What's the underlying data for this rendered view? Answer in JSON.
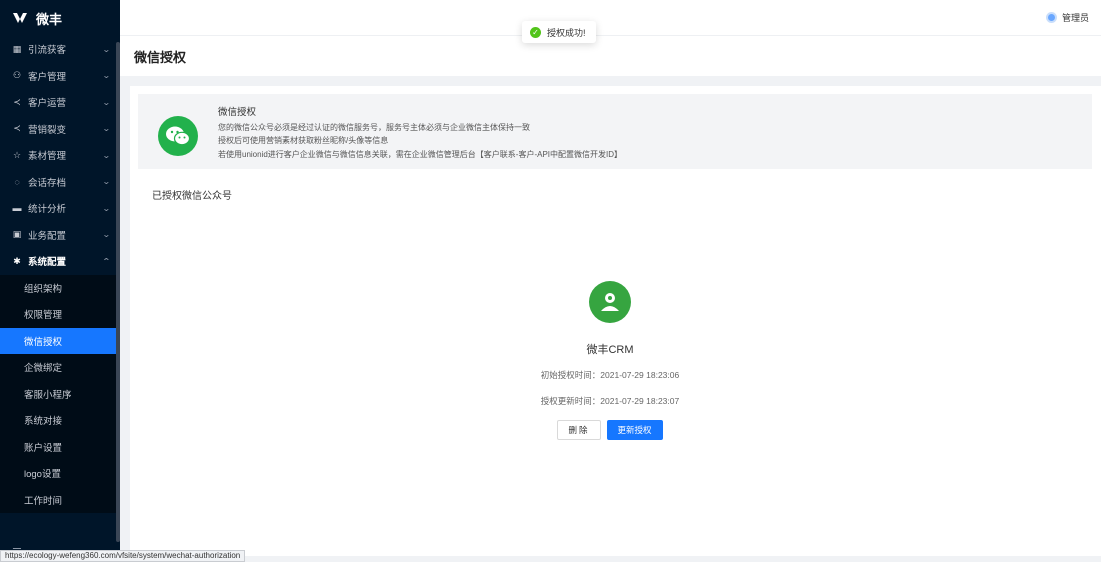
{
  "app": {
    "name": "微丰"
  },
  "sidebar": {
    "items": [
      {
        "label": "引流获客",
        "icon": "qr-code-icon",
        "glyph": "▦"
      },
      {
        "label": "客户管理",
        "icon": "users-icon",
        "glyph": "⚇"
      },
      {
        "label": "客户运营",
        "icon": "share-icon",
        "glyph": "≺"
      },
      {
        "label": "营销裂变",
        "icon": "share-icon",
        "glyph": "≺"
      },
      {
        "label": "素材管理",
        "icon": "star-icon",
        "glyph": "☆"
      },
      {
        "label": "会话存档",
        "icon": "chat-icon",
        "glyph": "◌"
      },
      {
        "label": "统计分析",
        "icon": "bar-chart-icon",
        "glyph": "▬"
      },
      {
        "label": "业务配置",
        "icon": "grid-icon",
        "glyph": "▣"
      },
      {
        "label": "系统配置",
        "icon": "gear-icon",
        "glyph": "✱"
      }
    ],
    "subitems": [
      "组织架构",
      "权限管理",
      "微信授权",
      "企微绑定",
      "客服小程序",
      "系统对接",
      "账户设置",
      "logo设置",
      "工作时间"
    ],
    "active_subitem": "微信授权",
    "footer_glyph": "☰"
  },
  "header": {
    "user_name": "管理员"
  },
  "toast": {
    "text": "授权成功!"
  },
  "page": {
    "title": "微信授权"
  },
  "info": {
    "title": "微信授权",
    "lines": [
      "您的微信公众号必须是经过认证的微信服务号，服务号主体必须与企业微信主体保持一致",
      "授权后可使用营销素材获取粉丝昵称/头像等信息",
      "若使用unionid进行客户企业微信与微信信息关联，需在企业微信管理后台【客户联系-客户-API中配置微信开发ID】"
    ]
  },
  "section": {
    "label": "已授权微信公众号"
  },
  "account": {
    "name": "微丰CRM",
    "first_auth": "初始授权时间：2021-07-29 18:23:06",
    "updated_auth": "授权更新时间：2021-07-29 18:23:07",
    "delete_label": "删除",
    "update_label": "更新授权"
  },
  "statusbar": {
    "url": "https://ecology-wefeng360.com/vfsite/system/wechat-authorization"
  },
  "colors": {
    "sidebar_bg": "#001529",
    "accent": "#1677ff",
    "wechat_green": "#22b14c",
    "success": "#52c41a"
  }
}
